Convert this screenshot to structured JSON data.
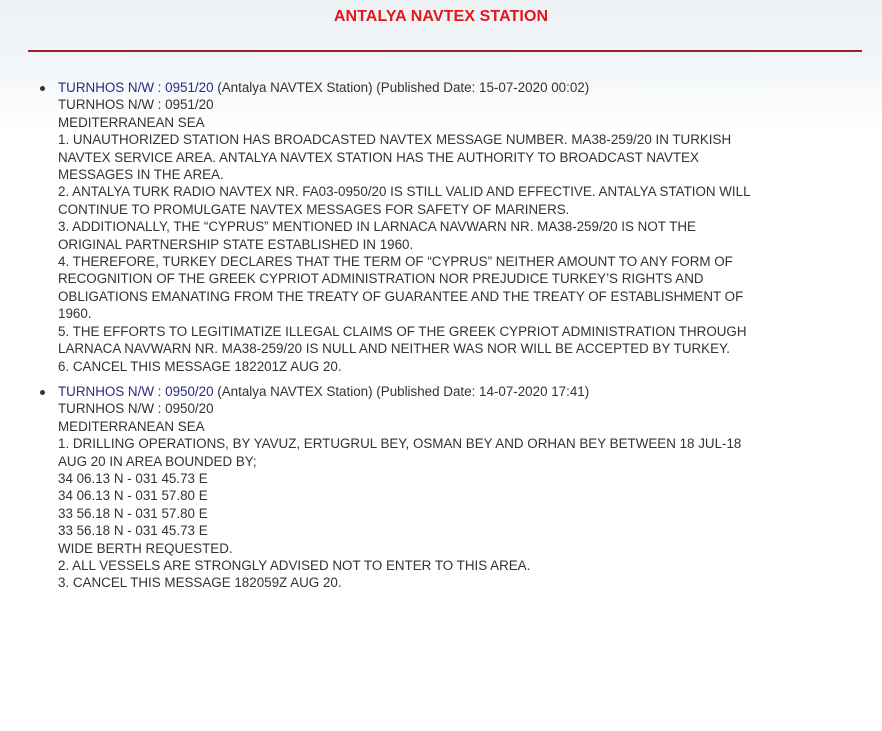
{
  "page": {
    "title": "ANTALYA NAVTEX STATION"
  },
  "messages": [
    {
      "prefix": "TURNHOS N/W : ",
      "number": "0951/20",
      "station": "(Antalya NAVTEX Station)",
      "published": "(Published Date: 15-07-2020 00:02)",
      "lines": [
        "TURNHOS N/W : 0951/20",
        "MEDITERRANEAN SEA"
      ],
      "paragraphs": [
        [
          "1. UNAUTHORIZED STATION HAS BROADCASTED NAVTEX MESSAGE NUMBER. MA38-259/20 IN TURKISH",
          "NAVTEX SERVICE AREA. ANTALYA NAVTEX STATION HAS THE AUTHORITY TO BROADCAST NAVTEX",
          "MESSAGES IN THE AREA."
        ],
        [
          "2. ANTALYA TURK RADIO NAVTEX NR. FA03-0950/20 IS STILL VALID AND EFFECTIVE. ANTALYA STATION WILL",
          "CONTINUE TO PROMULGATE NAVTEX MESSAGES FOR SAFETY OF MARINERS."
        ],
        [
          "3. ADDITIONALLY, THE “CYPRUS” MENTIONED IN LARNACA NAVWARN NR. MA38-259/20 IS NOT THE",
          "ORIGINAL PARTNERSHIP STATE ESTABLISHED IN 1960."
        ],
        [
          "4. THEREFORE, TURKEY DECLARES THAT THE TERM OF “CYPRUS” NEITHER AMOUNT TO ANY FORM OF",
          "RECOGNITION OF THE GREEK CYPRIOT ADMINISTRATION NOR PREJUDICE TURKEY’S RIGHTS AND",
          "OBLIGATIONS EMANATING FROM THE TREATY OF GUARANTEE AND THE TREATY OF ESTABLISHMENT OF",
          "1960."
        ],
        [
          "5. THE EFFORTS TO LEGITIMATIZE ILLEGAL CLAIMS OF THE GREEK CYPRIOT ADMINISTRATION THROUGH",
          "LARNACA NAVWARN NR. MA38-259/20 IS NULL AND NEITHER WAS NOR WILL BE ACCEPTED BY TURKEY."
        ],
        [
          "6. CANCEL THIS MESSAGE 182201Z AUG 20."
        ]
      ]
    },
    {
      "prefix": "TURNHOS N/W : ",
      "number": "0950/20",
      "station": "(Antalya NAVTEX Station)",
      "published": "(Published Date: 14-07-2020 17:41)",
      "lines": [
        "TURNHOS N/W : 0950/20",
        "MEDITERRANEAN SEA"
      ],
      "paragraphs": [
        [
          "1. DRILLING OPERATIONS, BY YAVUZ, ERTUGRUL BEY, OSMAN BEY AND ORHAN BEY BETWEEN 18 JUL-18",
          "AUG 20 IN AREA BOUNDED BY;"
        ],
        [
          "34 06.13 N - 031 45.73 E"
        ],
        [
          "34 06.13 N - 031 57.80 E"
        ],
        [
          "33 56.18 N - 031 57.80 E"
        ],
        [
          "33 56.18 N - 031 45.73 E"
        ],
        [
          "WIDE BERTH REQUESTED."
        ],
        [
          "2. ALL VESSELS ARE STRONGLY ADVISED NOT TO ENTER TO THIS AREA."
        ],
        [
          "3. CANCEL THIS MESSAGE 182059Z AUG 20."
        ]
      ]
    }
  ]
}
